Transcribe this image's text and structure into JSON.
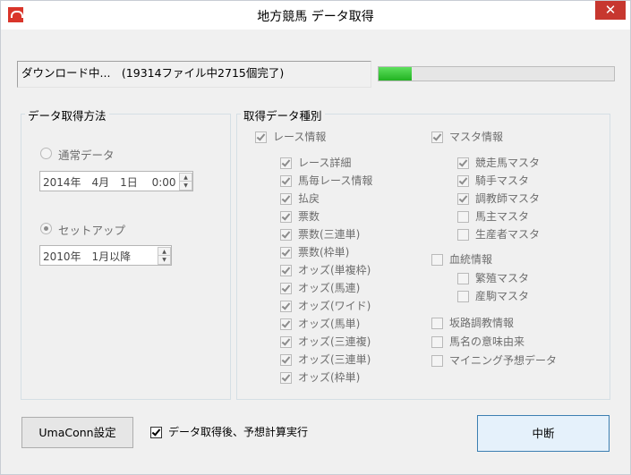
{
  "window": {
    "title": "地方競馬 データ取得",
    "close_glyph": "✕"
  },
  "status": {
    "text": "ダウンロード中...　(19314ファイル中2715個完了)"
  },
  "progress": {
    "fraction": 0.14
  },
  "method_group": {
    "title": "データ取得方法",
    "normal": {
      "label": "通常データ",
      "selected": false,
      "value": "2014年　4月　1日　 0:00"
    },
    "setup": {
      "label": "セットアップ",
      "selected": true,
      "value": "2010年　1月以降"
    }
  },
  "type_group": {
    "title": "取得データ種別",
    "race": {
      "label": "レース情報",
      "checked": true,
      "items": [
        {
          "label": "レース詳細",
          "checked": true
        },
        {
          "label": "馬毎レース情報",
          "checked": true
        },
        {
          "label": "払戻",
          "checked": true
        },
        {
          "label": "票数",
          "checked": true
        },
        {
          "label": "票数(三連単)",
          "checked": true
        },
        {
          "label": "票数(枠単)",
          "checked": true
        },
        {
          "label": "オッズ(単複枠)",
          "checked": true
        },
        {
          "label": "オッズ(馬連)",
          "checked": true
        },
        {
          "label": "オッズ(ワイド)",
          "checked": true
        },
        {
          "label": "オッズ(馬単)",
          "checked": true
        },
        {
          "label": "オッズ(三連複)",
          "checked": true
        },
        {
          "label": "オッズ(三連単)",
          "checked": true
        },
        {
          "label": "オッズ(枠単)",
          "checked": true
        }
      ]
    },
    "master": {
      "label": "マスタ情報",
      "checked": true,
      "items": [
        {
          "label": "競走馬マスタ",
          "checked": true
        },
        {
          "label": "騎手マスタ",
          "checked": true
        },
        {
          "label": "調教師マスタ",
          "checked": true
        },
        {
          "label": "馬主マスタ",
          "checked": false
        },
        {
          "label": "生産者マスタ",
          "checked": false
        }
      ]
    },
    "bloodline": {
      "label": "血統情報",
      "checked": false,
      "items": [
        {
          "label": "繁殖マスタ",
          "checked": false
        },
        {
          "label": "産駒マスタ",
          "checked": false
        }
      ]
    },
    "others": [
      {
        "label": "坂路調教情報",
        "checked": false
      },
      {
        "label": "馬名の意味由来",
        "checked": false
      },
      {
        "label": "マイニング予想データ",
        "checked": false
      }
    ]
  },
  "footer": {
    "umaconn_label": "UmaConn設定",
    "post_label": "データ取得後、予想計算実行",
    "post_checked": true,
    "action_label": "中断"
  }
}
